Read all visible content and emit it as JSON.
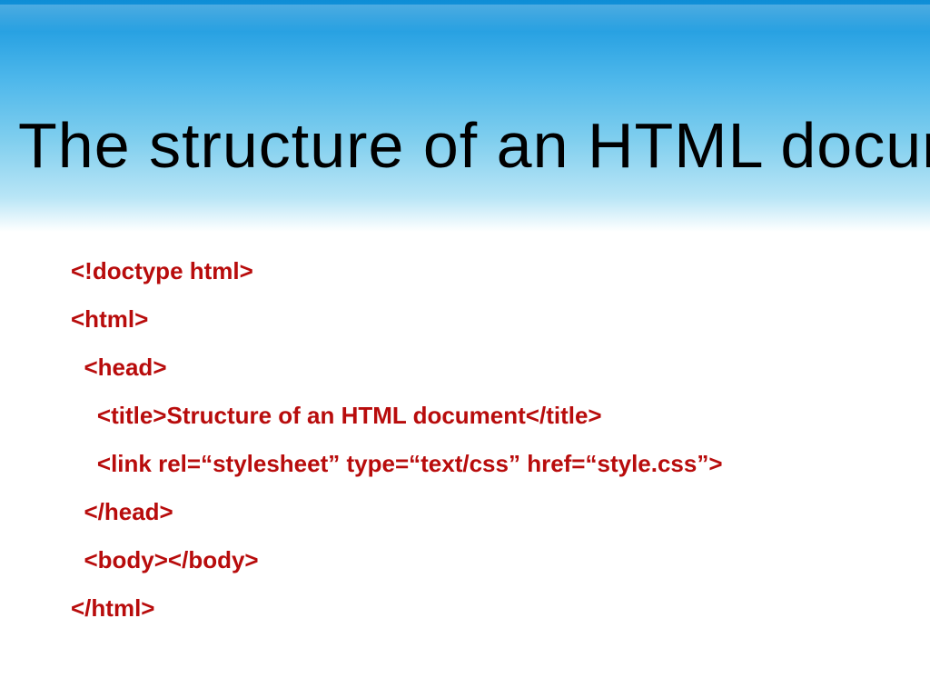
{
  "slide": {
    "title": "The structure of an HTML document",
    "code_lines": [
      "<!doctype html>",
      "<html>",
      "  <head>",
      "    <title>Structure of an HTML document</title>",
      "    <link rel=“stylesheet” type=“text/css” href=“style.css”>",
      "  </head>",
      "  <body></body>",
      "</html>"
    ]
  }
}
